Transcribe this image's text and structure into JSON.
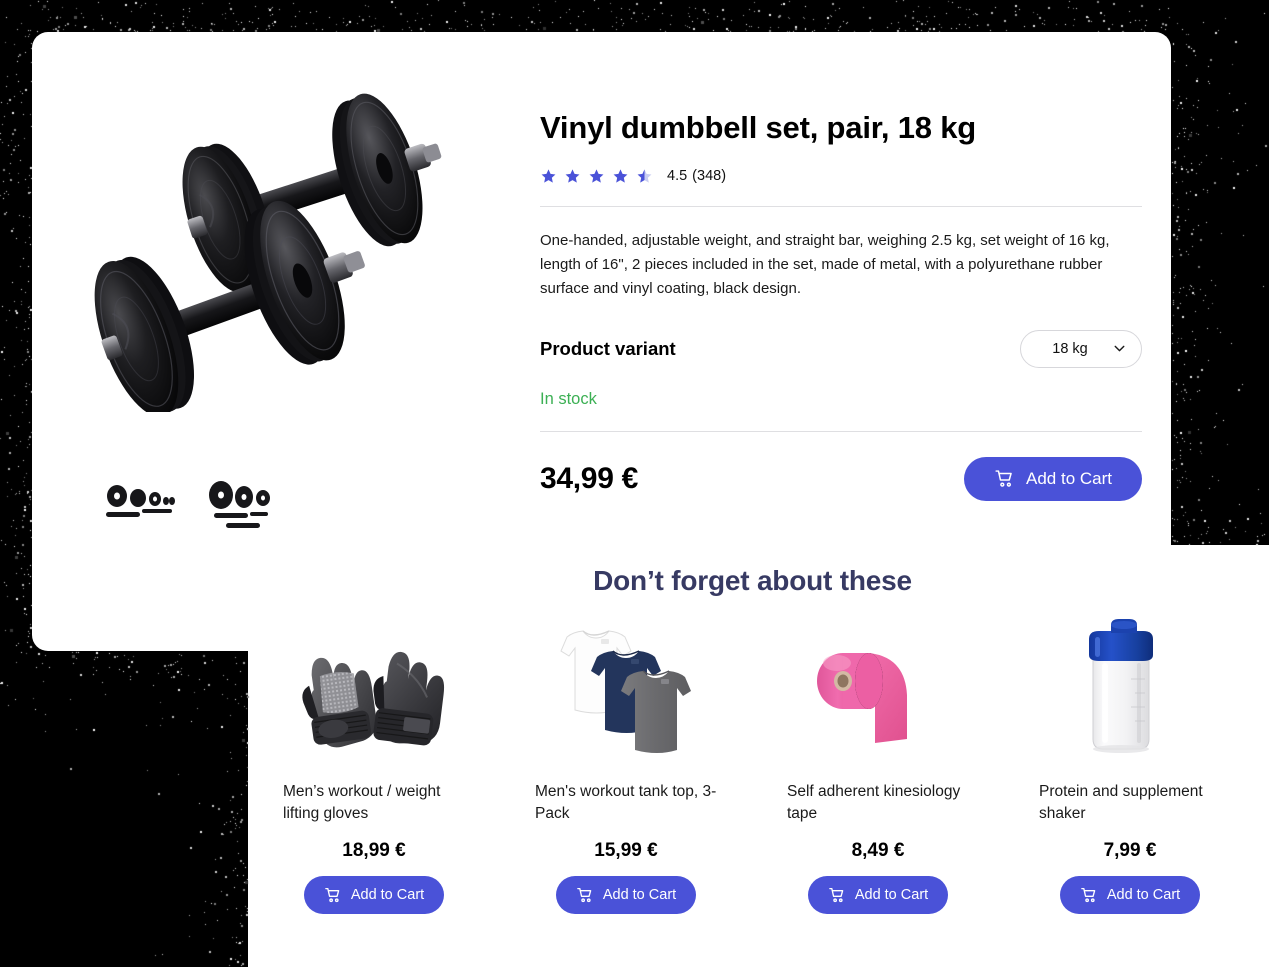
{
  "product": {
    "title": "Vinyl dumbbell set, pair, 18 kg",
    "rating_value": "4.5",
    "rating_count": "(348)",
    "rating_stars_full": 4,
    "rating_stars_half": 1,
    "description": "One-handed, adjustable weight, and straight bar, weighing 2.5 kg, set weight of 16 kg, length of 16\", 2 pieces included in the set, made of metal, with a polyurethane rubber surface and vinyl coating, black design.",
    "variant_label": "Product variant",
    "variant_selected": "18 kg",
    "variant_options": [
      "18 kg"
    ],
    "stock_status": "In stock",
    "price": "34,99 €",
    "add_to_cart_label": "Add to Cart",
    "hero_image_alt": "vinyl-dumbbell-pair",
    "thumbnails": [
      {
        "alt": "dumbbell-set-thumbnail-1"
      },
      {
        "alt": "dumbbell-set-thumbnail-2"
      }
    ]
  },
  "recommendations": {
    "heading": "Don’t forget about these",
    "items": [
      {
        "name": "Men’s workout / weight lifting gloves",
        "price": "18,99 €",
        "add_to_cart_label": "Add to Cart",
        "image_alt": "workout-gloves"
      },
      {
        "name": "Men's workout tank top, 3-Pack",
        "price": "15,99 €",
        "add_to_cart_label": "Add to Cart",
        "image_alt": "tank-tops-3-pack"
      },
      {
        "name": "Self adherent kinesiology tape",
        "price": "8,49 €",
        "add_to_cart_label": "Add to Cart",
        "image_alt": "kinesiology-tape"
      },
      {
        "name": "Protein and supplement shaker",
        "price": "7,99 €",
        "add_to_cart_label": "Add to Cart",
        "image_alt": "protein-shaker"
      }
    ]
  },
  "colors": {
    "accent": "#4a52d8",
    "star": "#4a52d8",
    "star_empty": "#c9cdf2",
    "in_stock": "#3cb054",
    "heading_navy": "#373a63",
    "backdrop": "#000000",
    "card": "#ffffff",
    "divider": "#dfdfe2"
  }
}
